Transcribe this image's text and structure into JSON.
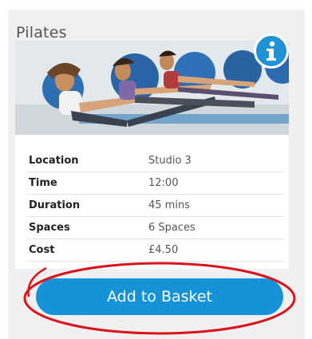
{
  "class_card": {
    "title": "Pilates",
    "info_icon": "info-icon",
    "details": [
      {
        "label": "Location",
        "value": "Studio 3"
      },
      {
        "label": "Time",
        "value": "12:00"
      },
      {
        "label": "Duration",
        "value": "45 mins"
      },
      {
        "label": "Spaces",
        "value": "6 Spaces"
      },
      {
        "label": "Cost",
        "value": "£4.50"
      }
    ],
    "add_button_label": "Add to Basket"
  },
  "colors": {
    "accent": "#1592d8",
    "annotation": "#d9141c"
  }
}
